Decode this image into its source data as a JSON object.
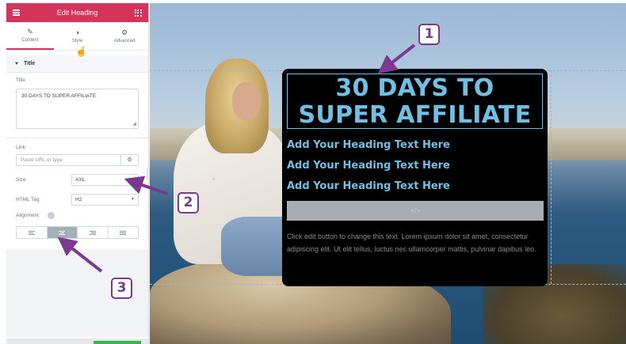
{
  "panel": {
    "title": "Edit Heading",
    "tabs": [
      {
        "label": "Content",
        "icon": "pencil-icon",
        "active": true
      },
      {
        "label": "Style",
        "icon": "contrast-icon",
        "active": false
      },
      {
        "label": "Advanced",
        "icon": "gear-icon",
        "active": false
      }
    ],
    "section_title": "Title",
    "title_label": "Title",
    "title_value": "30 DAYS TO SUPER AFFILIATE",
    "link_label": "Link",
    "link_placeholder": "Paste URL or type",
    "size_label": "Size",
    "size_value": "XXL",
    "html_tag_label": "HTML Tag",
    "html_tag_value": "H2",
    "alignment_label": "Alignment",
    "alignment_active": "center",
    "accent_color": "#d4345a"
  },
  "canvas": {
    "main_heading": "30 DAYS TO SUPER AFFILIATE",
    "sub_headings": [
      "Add Your Heading Text Here",
      "Add Your Heading Text Here",
      "Add Your Heading Text Here"
    ],
    "divider_glyph": "</>",
    "body_text": "Click edit button to change this text. Lorem ipsum dolor sit amet, consectetur adipiscing elit. Ut elit tellus, luctus nec ullamcorper mattis, pulvinar dapibus leo.",
    "heading_color": "#6ec1e4"
  },
  "annotations": {
    "badge_1": "1",
    "badge_2": "2",
    "badge_3": "3",
    "color": "#7b3a8f"
  }
}
